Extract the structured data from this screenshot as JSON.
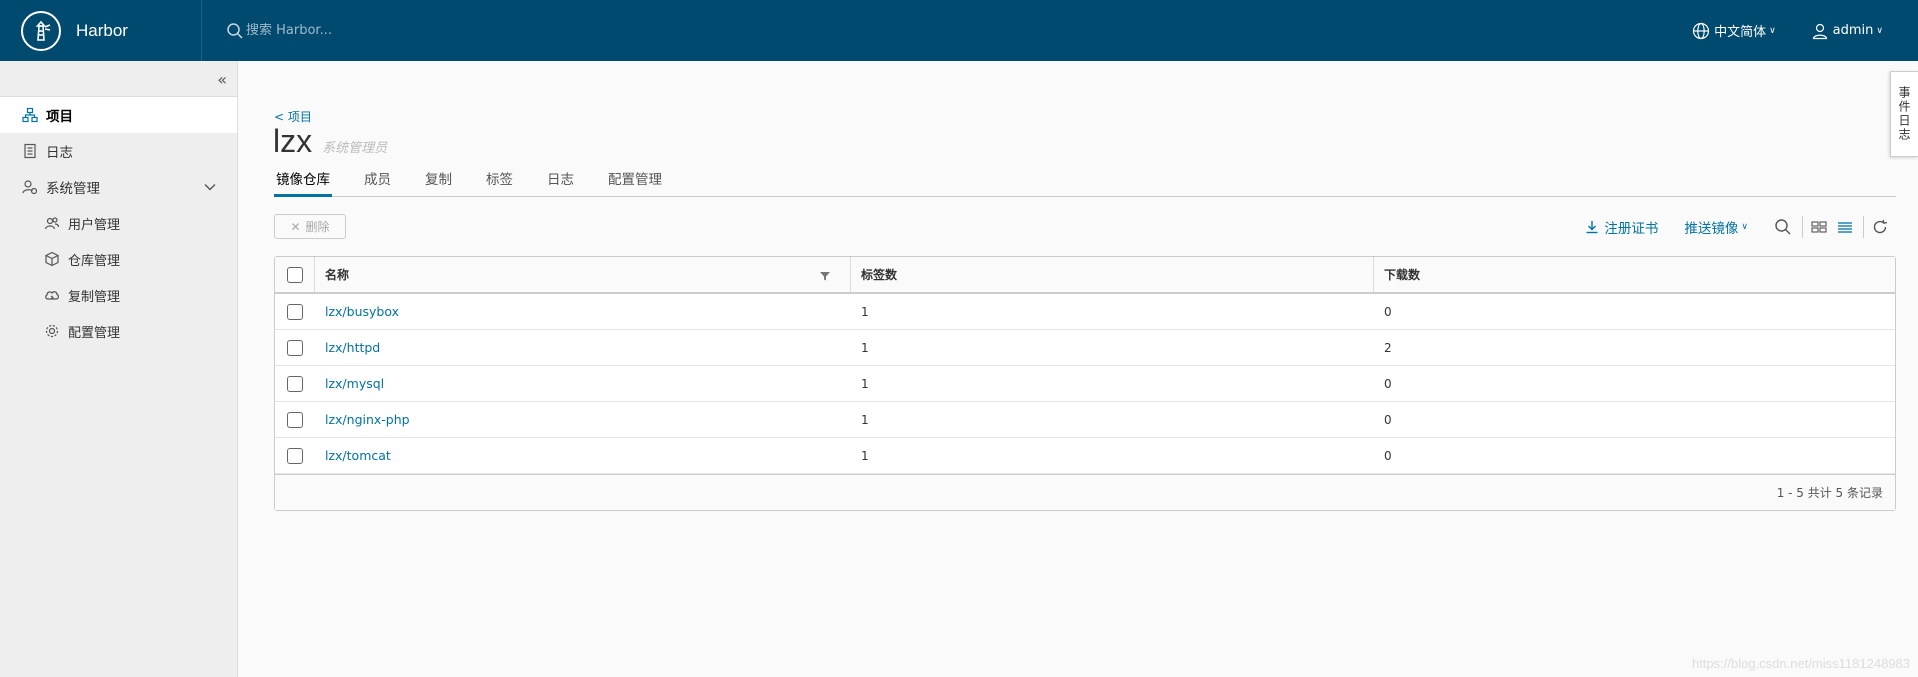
{
  "header": {
    "brand": "Harbor",
    "search_placeholder": "搜索 Harbor...",
    "language": "中文简体",
    "user": "admin"
  },
  "sidebar": {
    "items": [
      {
        "label": "项目",
        "icon": "projects-icon",
        "active": true
      },
      {
        "label": "日志",
        "icon": "logs-icon"
      },
      {
        "label": "系统管理",
        "icon": "system-admin-icon"
      },
      {
        "label": "用户管理",
        "icon": "users-icon"
      },
      {
        "label": "仓库管理",
        "icon": "registry-icon"
      },
      {
        "label": "复制管理",
        "icon": "replication-icon"
      },
      {
        "label": "配置管理",
        "icon": "config-icon"
      }
    ]
  },
  "main": {
    "breadcrumb": "< 项目",
    "title": "lzx",
    "role": "系统管理员",
    "tabs": [
      "镜像仓库",
      "成员",
      "复制",
      "标签",
      "日志",
      "配置管理"
    ],
    "delete_label": "删除",
    "register_cert_label": "注册证书",
    "push_image_label": "推送镜像"
  },
  "table": {
    "headers": [
      "名称",
      "标签数",
      "下载数"
    ],
    "rows": [
      {
        "name": "lzx/busybox",
        "tags": "1",
        "downloads": "0"
      },
      {
        "name": "lzx/httpd",
        "tags": "1",
        "downloads": "2"
      },
      {
        "name": "lzx/mysql",
        "tags": "1",
        "downloads": "0"
      },
      {
        "name": "lzx/nginx-php",
        "tags": "1",
        "downloads": "0"
      },
      {
        "name": "lzx/tomcat",
        "tags": "1",
        "downloads": "0"
      }
    ],
    "footer": "1 - 5 共计 5 条记录"
  },
  "event_tab": "事件日志",
  "watermark": "https://blog.csdn.net/miss1181248983",
  "colors": {
    "header_bg": "#004a70",
    "link": "#0072a3",
    "sidebar_bg": "#eeeeee"
  }
}
